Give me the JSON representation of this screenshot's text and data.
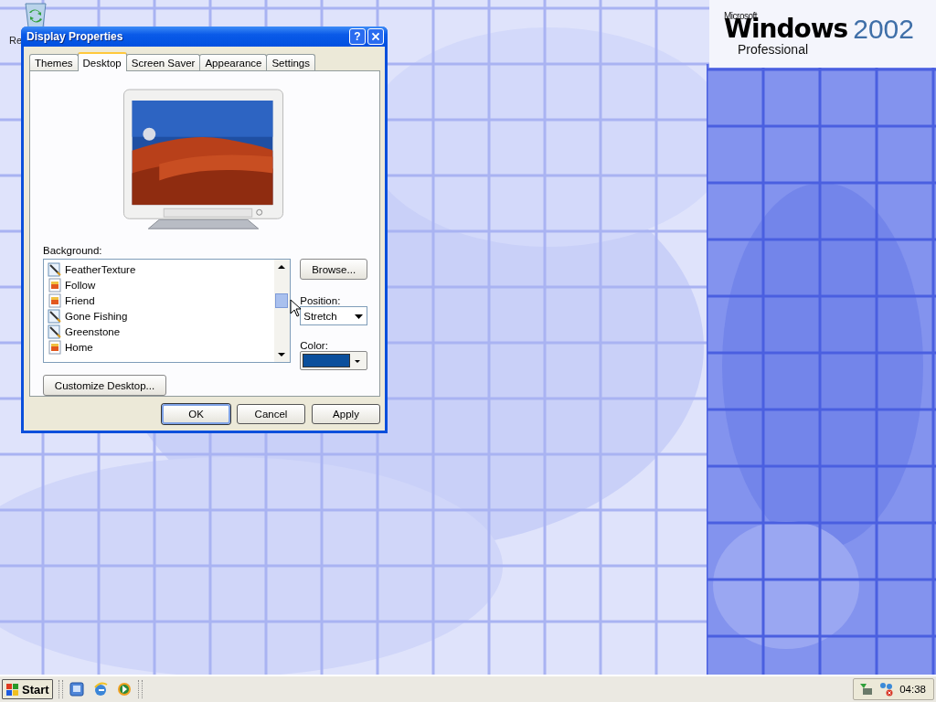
{
  "desktop": {
    "icons": [
      {
        "label": "Re"
      }
    ],
    "branding": {
      "maker": "Microsoft",
      "product": "Windows",
      "version": "2002",
      "edition": "Professional"
    }
  },
  "dialog": {
    "title": "Display Properties",
    "help_button": "?",
    "tabs": [
      {
        "label": "Themes",
        "selected": false
      },
      {
        "label": "Desktop",
        "selected": true
      },
      {
        "label": "Screen Saver",
        "selected": false
      },
      {
        "label": "Appearance",
        "selected": false
      },
      {
        "label": "Settings",
        "selected": false
      }
    ],
    "background_label": "Background:",
    "backgrounds": [
      {
        "name": "FeatherTexture",
        "kind": "bitmap",
        "selected": false
      },
      {
        "name": "Follow",
        "kind": "jpeg",
        "selected": false
      },
      {
        "name": "Friend",
        "kind": "jpeg",
        "selected": false
      },
      {
        "name": "Gone Fishing",
        "kind": "bitmap",
        "selected": false
      },
      {
        "name": "Greenstone",
        "kind": "bitmap",
        "selected": false
      },
      {
        "name": "Home",
        "kind": "jpeg",
        "selected": false
      }
    ],
    "browse_button": "Browse...",
    "position_label": "Position:",
    "position": {
      "value": "Stretch"
    },
    "color_label": "Color:",
    "color_picker": {
      "color": "#0b4f9c"
    },
    "customize_button": "Customize Desktop...",
    "buttons": [
      {
        "label": "OK",
        "default": true
      },
      {
        "label": "Cancel",
        "default": false
      },
      {
        "label": "Apply",
        "default": false
      }
    ]
  },
  "taskbar": {
    "start": "Start",
    "clock": "04:38"
  }
}
